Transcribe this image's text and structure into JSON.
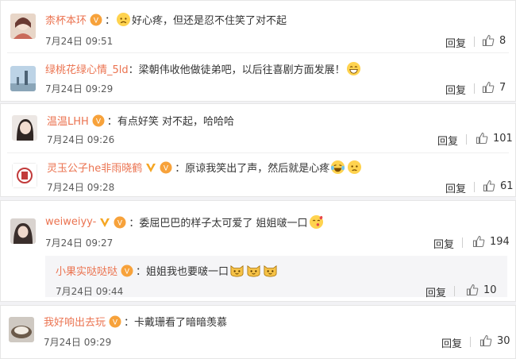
{
  "colors": {
    "username": "#eb7350",
    "text": "#333333",
    "time": "#5a5a5a",
    "page_bg": "#f2f2f5",
    "sub_bg": "#f5f5f7"
  },
  "comments": [
    {
      "username": "柰杯本环",
      "sep": "：",
      "text": "好心疼，但还是忍不住笑了对不起",
      "time": "7月24日 09:51",
      "reply": "回复",
      "likes": "8",
      "emoji_before": "sad-face-emoji"
    },
    {
      "username": "绿桃花绿心情_5ld",
      "sep": "：",
      "text": "梁朝伟收他做徒弟吧，以后往喜剧方面发展！",
      "time": "7月24日 09:29",
      "reply": "回复",
      "likes": "7",
      "emoji_after": "grin-face-emoji"
    },
    {
      "username": "温温LHH",
      "sep": "：",
      "text": "有点好笑 对不起，哈哈哈",
      "time": "7月24日 09:26",
      "reply": "回复",
      "likes": "101"
    },
    {
      "username": "灵玉公子he非雨晓鹤",
      "sep": "：",
      "text": "原谅我笑出了声，然后就是心疼",
      "time": "7月24日 09:28",
      "reply": "回复",
      "likes": "61",
      "emoji_after": [
        "laugh-cry-emoji",
        "worried-face-emoji"
      ]
    },
    {
      "username": "weiweiyy-",
      "sep": "：",
      "text": "委屈巴巴的样子太可爱了 姐姐啵一口",
      "time": "7月24日 09:27",
      "reply": "回复",
      "likes": "194",
      "emoji_after": "kiss-face-emoji"
    },
    {
      "username": "小果实哒哒哒",
      "sep": "：",
      "text": "姐姐我也要啵一口",
      "time": "7月24日 09:44",
      "reply": "回复",
      "likes": "10",
      "emoji_after": [
        "cat-face-emoji",
        "cat-face-emoji",
        "cat-face-emoji"
      ]
    },
    {
      "username": "我好响出去玩",
      "sep": "：",
      "text": "卡戴珊看了暗暗羡慕",
      "time": "7月24日 09:29",
      "reply": "回复",
      "likes": "30"
    }
  ]
}
